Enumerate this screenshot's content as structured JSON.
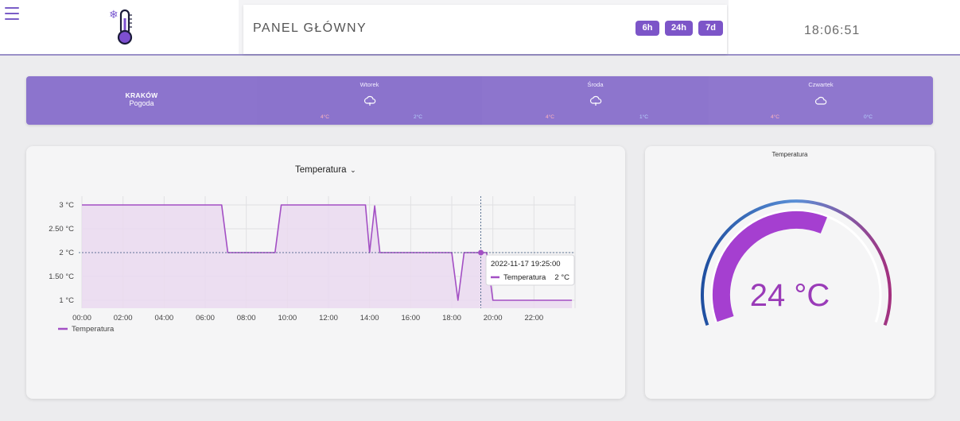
{
  "header": {
    "page_title": "PANEL GŁÓWNY",
    "range_buttons": [
      "6h",
      "24h",
      "7d"
    ],
    "clock": "18:06:51"
  },
  "weather": {
    "city": "KRAKÓW",
    "subtitle": "Pogoda",
    "days": [
      {
        "name": "Wtorek",
        "icon": "cloud-rain-icon",
        "high": "4°C",
        "low": "2°C"
      },
      {
        "name": "Środa",
        "icon": "cloud-rain-icon",
        "high": "4°C",
        "low": "1°C"
      },
      {
        "name": "Czwartek",
        "icon": "cloud-icon",
        "high": "4°C",
        "low": "0°C"
      }
    ]
  },
  "chart": {
    "title": "Temperatura",
    "legend": "Temperatura",
    "tooltip": {
      "time": "2022-11-17 19:25:00",
      "series": "Temperatura",
      "value": "2 °C"
    }
  },
  "chart_data": {
    "type": "area",
    "title": "Temperatura",
    "x_ticks": [
      "00:00",
      "02:00",
      "04:00",
      "06:00",
      "08:00",
      "10:00",
      "12:00",
      "14:00",
      "16:00",
      "18:00",
      "20:00",
      "22:00"
    ],
    "y_ticks": [
      "1 °C",
      "1.50 °C",
      "2 °C",
      "2.50 °C",
      "3 °C"
    ],
    "ylim": [
      1,
      3
    ],
    "xlim_hours": [
      0,
      24
    ],
    "series": [
      {
        "name": "Temperatura",
        "x_hours": [
          0,
          6.8,
          7.1,
          9.4,
          9.7,
          13.8,
          14.0,
          14.25,
          14.5,
          14.8,
          18.0,
          18.3,
          18.6,
          19.7,
          20.0,
          23.85
        ],
        "values": [
          3,
          3,
          2,
          2,
          3,
          3,
          2,
          2.98,
          2,
          2,
          2,
          1,
          2,
          2,
          1,
          1
        ]
      }
    ],
    "grid": true,
    "legend_position": "bottom-left",
    "colors": {
      "line": "#a34fc4",
      "fill": "#ead9f0"
    }
  },
  "gauge": {
    "title": "Temperatura",
    "value": 24,
    "display": "24 °C",
    "min": 0,
    "max": 40
  }
}
